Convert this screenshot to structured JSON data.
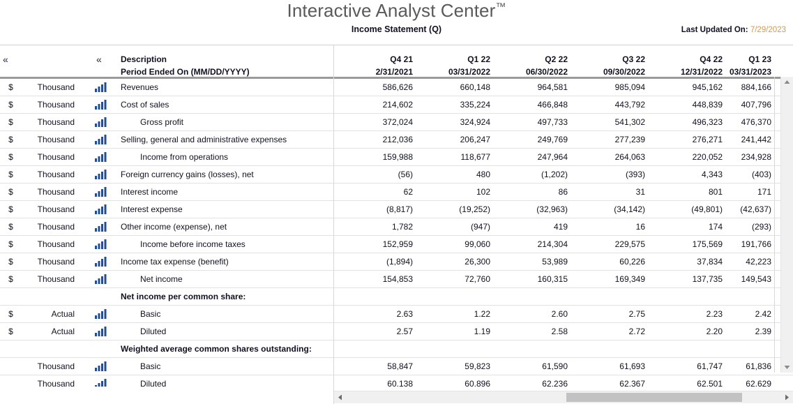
{
  "header": {
    "app_title": "Interactive Analyst Center",
    "trademark": "™",
    "subtitle": "Income Statement (Q)",
    "last_updated_label": "Last Updated On:",
    "last_updated_value": "7/29/2023",
    "last_updated_color": "#d49a52",
    "collapse_icon": "«"
  },
  "table": {
    "description_header": "Description",
    "period_header": "Period Ended On (MM/DD/YYYY)",
    "columns": [
      {
        "quarter": "Q4 21",
        "period": "2/31/2021"
      },
      {
        "quarter": "Q1 22",
        "period": "03/31/2022"
      },
      {
        "quarter": "Q2 22",
        "period": "06/30/2022"
      },
      {
        "quarter": "Q3 22",
        "period": "09/30/2022"
      },
      {
        "quarter": "Q4 22",
        "period": "12/31/2022"
      },
      {
        "quarter": "Q1 23",
        "period": "03/31/2023"
      }
    ],
    "rows": [
      {
        "currency": "$",
        "unit": "Thousand",
        "icon": "bar-chart-icon",
        "description": "Revenues",
        "indent": false,
        "section": false,
        "values": [
          "586,626",
          "660,148",
          "964,581",
          "985,094",
          "945,162",
          "884,166"
        ]
      },
      {
        "currency": "$",
        "unit": "Thousand",
        "icon": "bar-chart-icon",
        "description": "Cost of sales",
        "indent": false,
        "section": false,
        "values": [
          "214,602",
          "335,224",
          "466,848",
          "443,792",
          "448,839",
          "407,796"
        ]
      },
      {
        "currency": "$",
        "unit": "Thousand",
        "icon": "bar-chart-icon",
        "description": "Gross profit",
        "indent": true,
        "section": false,
        "values": [
          "372,024",
          "324,924",
          "497,733",
          "541,302",
          "496,323",
          "476,370"
        ]
      },
      {
        "currency": "$",
        "unit": "Thousand",
        "icon": "bar-chart-icon",
        "description": "Selling, general and administrative expenses",
        "indent": false,
        "section": false,
        "values": [
          "212,036",
          "206,247",
          "249,769",
          "277,239",
          "276,271",
          "241,442"
        ]
      },
      {
        "currency": "$",
        "unit": "Thousand",
        "icon": "bar-chart-icon",
        "description": "Income from operations",
        "indent": true,
        "section": false,
        "values": [
          "159,988",
          "118,677",
          "247,964",
          "264,063",
          "220,052",
          "234,928"
        ]
      },
      {
        "currency": "$",
        "unit": "Thousand",
        "icon": "bar-chart-icon",
        "description": "Foreign currency gains (losses), net",
        "indent": false,
        "section": false,
        "values": [
          "(56)",
          "480",
          "(1,202)",
          "(393)",
          "4,343",
          "(403)"
        ]
      },
      {
        "currency": "$",
        "unit": "Thousand",
        "icon": "bar-chart-icon",
        "description": "Interest income",
        "indent": false,
        "section": false,
        "values": [
          "62",
          "102",
          "86",
          "31",
          "801",
          "171"
        ]
      },
      {
        "currency": "$",
        "unit": "Thousand",
        "icon": "bar-chart-icon",
        "description": "Interest expense",
        "indent": false,
        "section": false,
        "values": [
          "(8,817)",
          "(19,252)",
          "(32,963)",
          "(34,142)",
          "(49,801)",
          "(42,637)"
        ]
      },
      {
        "currency": "$",
        "unit": "Thousand",
        "icon": "bar-chart-icon",
        "description": "Other income (expense), net",
        "indent": false,
        "section": false,
        "values": [
          "1,782",
          "(947)",
          "419",
          "16",
          "174",
          "(293)"
        ]
      },
      {
        "currency": "$",
        "unit": "Thousand",
        "icon": "bar-chart-icon",
        "description": "Income before income taxes",
        "indent": true,
        "section": false,
        "values": [
          "152,959",
          "99,060",
          "214,304",
          "229,575",
          "175,569",
          "191,766"
        ]
      },
      {
        "currency": "$",
        "unit": "Thousand",
        "icon": "bar-chart-icon",
        "description": "Income tax expense (benefit)",
        "indent": false,
        "section": false,
        "values": [
          "(1,894)",
          "26,300",
          "53,989",
          "60,226",
          "37,834",
          "42,223"
        ]
      },
      {
        "currency": "$",
        "unit": "Thousand",
        "icon": "bar-chart-icon",
        "description": "Net income",
        "indent": true,
        "section": false,
        "values": [
          "154,853",
          "72,760",
          "160,315",
          "169,349",
          "137,735",
          "149,543"
        ]
      },
      {
        "currency": "",
        "unit": "",
        "icon": "",
        "description": "Net income per common share:",
        "indent": false,
        "section": true,
        "values": [
          "",
          "",
          "",
          "",
          "",
          ""
        ]
      },
      {
        "currency": "$",
        "unit": "Actual",
        "icon": "bar-chart-icon",
        "description": "Basic",
        "indent": true,
        "section": false,
        "values": [
          "2.63",
          "1.22",
          "2.60",
          "2.75",
          "2.23",
          "2.42"
        ]
      },
      {
        "currency": "$",
        "unit": "Actual",
        "icon": "bar-chart-icon",
        "description": "Diluted",
        "indent": true,
        "section": false,
        "values": [
          "2.57",
          "1.19",
          "2.58",
          "2.72",
          "2.20",
          "2.39"
        ]
      },
      {
        "currency": "",
        "unit": "",
        "icon": "",
        "description": "Weighted average common shares outstanding:",
        "indent": false,
        "section": true,
        "values": [
          "",
          "",
          "",
          "",
          "",
          ""
        ]
      },
      {
        "currency": "",
        "unit": "Thousand",
        "icon": "bar-chart-icon",
        "description": "Basic",
        "indent": true,
        "section": false,
        "values": [
          "58,847",
          "59,823",
          "61,590",
          "61,693",
          "61,747",
          "61,836"
        ]
      },
      {
        "currency": "",
        "unit": "Thousand",
        "icon": "bar-chart-icon",
        "description": "Diluted",
        "indent": true,
        "section": false,
        "values": [
          "60,138",
          "60,896",
          "62,236",
          "62,367",
          "62,501",
          "62,629"
        ]
      }
    ]
  },
  "scrollbars": {
    "vertical_up_icon": "scroll-up-arrow-icon",
    "vertical_down_icon": "scroll-down-arrow-icon",
    "horizontal_left_icon": "scroll-left-arrow-icon",
    "horizontal_right_icon": "scroll-right-arrow-icon"
  }
}
